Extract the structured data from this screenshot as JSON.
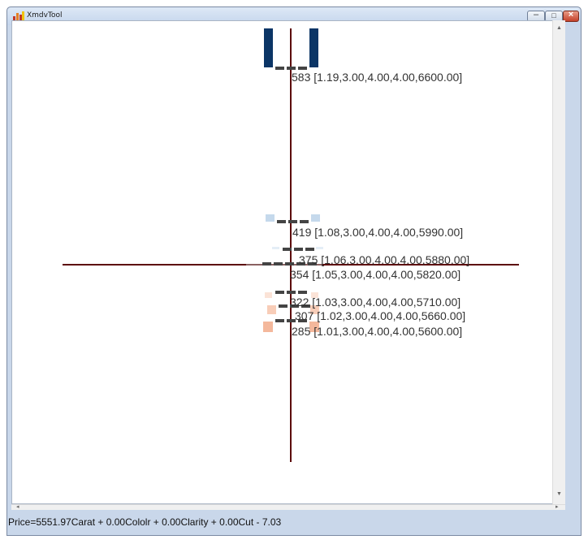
{
  "window": {
    "title": "XmdvTool"
  },
  "axis_labels": [
    {
      "id": "583",
      "text": "583 [1.19,3.00,4.00,4.00,6600.00]"
    },
    {
      "id": "419",
      "text": "419 [1.08,3.00,4.00,4.00,5990.00]"
    },
    {
      "id": "375",
      "text": "375 [1.06,3.00,4.00,4.00,5880.00]"
    },
    {
      "id": "354",
      "text": "354 [1.05,3.00,4.00,4.00,5820.00]"
    },
    {
      "id": "322",
      "text": "322 [1.03,3.00,4.00,4.00,5710.00]"
    },
    {
      "id": "307",
      "text": "307 [1.02,3.00,4.00,4.00,5660.00]"
    },
    {
      "id": "285",
      "text": "285 [1.01,3.00,4.00,4.00,5600.00]"
    }
  ],
  "status_text": "Price=5551.97Carat + 0.00Cololr + 0.00Clarity + 0.00Cut - 7.03",
  "colors": {
    "axis": "#5c0a0a",
    "high_bar": "#0b3566",
    "light_blue": "#c5d9ec",
    "salmon": "#f4b89c",
    "pale_salmon": "#fbe3d7",
    "dash": "#444444"
  },
  "icons": [
    "app-icon",
    "minimize-icon",
    "maximize-icon",
    "close-icon",
    "scroll-left-arrow-icon",
    "scroll-right-arrow-icon",
    "scroll-up-arrow-icon",
    "scroll-down-arrow-icon"
  ]
}
